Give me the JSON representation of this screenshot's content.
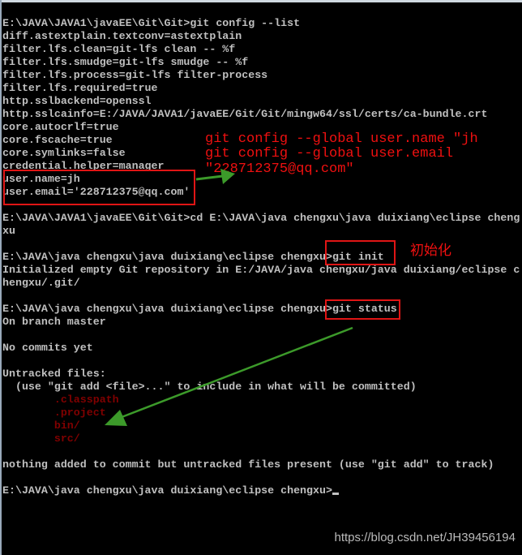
{
  "terminal": {
    "lines": [
      {
        "text": "E:\\JAVA\\JAVA1\\javaEE\\Git\\Git>git config --list"
      },
      {
        "text": "diff.astextplain.textconv=astextplain"
      },
      {
        "text": "filter.lfs.clean=git-lfs clean -- %f"
      },
      {
        "text": "filter.lfs.smudge=git-lfs smudge -- %f"
      },
      {
        "text": "filter.lfs.process=git-lfs filter-process"
      },
      {
        "text": "filter.lfs.required=true"
      },
      {
        "text": "http.sslbackend=openssl"
      },
      {
        "text": "http.sslcainfo=E:/JAVA/JAVA1/javaEE/Git/Git/mingw64/ssl/certs/ca-bundle.crt"
      },
      {
        "text": "core.autocrlf=true"
      },
      {
        "text": "core.fscache=true"
      },
      {
        "text": "core.symlinks=false"
      },
      {
        "text": "credential.helper=manager"
      },
      {
        "text": "user.name=jh"
      },
      {
        "text": "user.email='228712375@qq.com'"
      },
      {
        "text": ""
      },
      {
        "text": "E:\\JAVA\\JAVA1\\javaEE\\Git\\Git>cd E:\\JAVA\\java chengxu\\java duixiang\\eclipse cheng"
      },
      {
        "text": "xu"
      },
      {
        "text": ""
      },
      {
        "text": "E:\\JAVA\\java chengxu\\java duixiang\\eclipse chengxu>git init"
      },
      {
        "text": "Initialized empty Git repository in E:/JAVA/java chengxu/java duixiang/eclipse c"
      },
      {
        "text": "hengxu/.git/"
      },
      {
        "text": ""
      },
      {
        "text": "E:\\JAVA\\java chengxu\\java duixiang\\eclipse chengxu>git status"
      },
      {
        "text": "On branch master"
      },
      {
        "text": ""
      },
      {
        "text": "No commits yet"
      },
      {
        "text": ""
      },
      {
        "text": "Untracked files:"
      },
      {
        "text": "  (use \"git add <file>...\" to include in what will be committed)"
      },
      {
        "text": "        .classpath",
        "untracked": true
      },
      {
        "text": "        .project",
        "untracked": true
      },
      {
        "text": "        bin/",
        "untracked": true
      },
      {
        "text": "        src/",
        "untracked": true
      },
      {
        "text": ""
      },
      {
        "text": "nothing added to commit but untracked files present (use \"git add\" to track)"
      },
      {
        "text": ""
      },
      {
        "text": "E:\\JAVA\\java chengxu\\java duixiang\\eclipse chengxu>"
      }
    ]
  },
  "annotations": {
    "config_note": [
      "git config --global user.name \"jh",
      "git config --global user.email",
      "\"228712375@qq.com\""
    ],
    "init_note": "初始化"
  },
  "watermark": "https://blog.csdn.net/JH39456194",
  "colors": {
    "annotation": "#f01010",
    "arrow": "#3c9a2a",
    "untracked": "#800000"
  }
}
